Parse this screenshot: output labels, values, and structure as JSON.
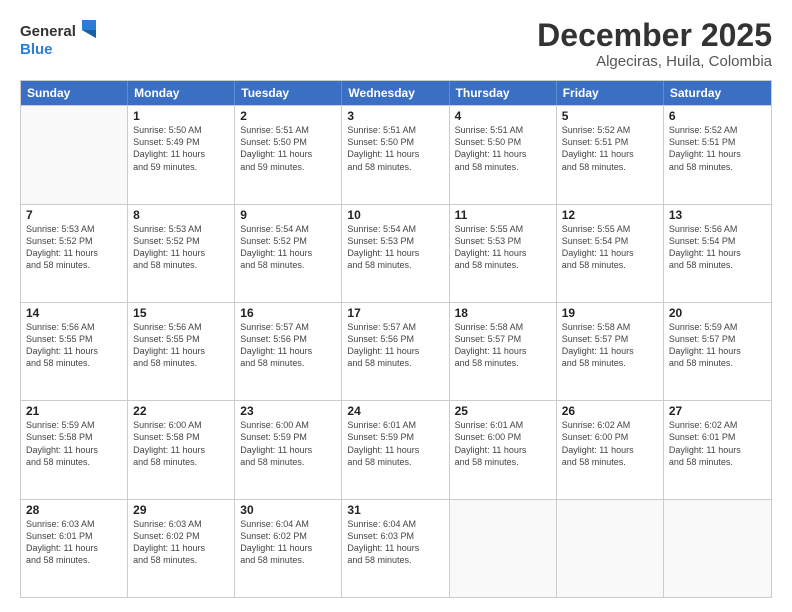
{
  "header": {
    "logo_line1": "General",
    "logo_line2": "Blue",
    "month": "December 2025",
    "location": "Algeciras, Huila, Colombia"
  },
  "weekdays": [
    "Sunday",
    "Monday",
    "Tuesday",
    "Wednesday",
    "Thursday",
    "Friday",
    "Saturday"
  ],
  "rows": [
    [
      {
        "day": "",
        "info": ""
      },
      {
        "day": "1",
        "info": "Sunrise: 5:50 AM\nSunset: 5:49 PM\nDaylight: 11 hours\nand 59 minutes."
      },
      {
        "day": "2",
        "info": "Sunrise: 5:51 AM\nSunset: 5:50 PM\nDaylight: 11 hours\nand 59 minutes."
      },
      {
        "day": "3",
        "info": "Sunrise: 5:51 AM\nSunset: 5:50 PM\nDaylight: 11 hours\nand 58 minutes."
      },
      {
        "day": "4",
        "info": "Sunrise: 5:51 AM\nSunset: 5:50 PM\nDaylight: 11 hours\nand 58 minutes."
      },
      {
        "day": "5",
        "info": "Sunrise: 5:52 AM\nSunset: 5:51 PM\nDaylight: 11 hours\nand 58 minutes."
      },
      {
        "day": "6",
        "info": "Sunrise: 5:52 AM\nSunset: 5:51 PM\nDaylight: 11 hours\nand 58 minutes."
      }
    ],
    [
      {
        "day": "7",
        "info": "Sunrise: 5:53 AM\nSunset: 5:52 PM\nDaylight: 11 hours\nand 58 minutes."
      },
      {
        "day": "8",
        "info": "Sunrise: 5:53 AM\nSunset: 5:52 PM\nDaylight: 11 hours\nand 58 minutes."
      },
      {
        "day": "9",
        "info": "Sunrise: 5:54 AM\nSunset: 5:52 PM\nDaylight: 11 hours\nand 58 minutes."
      },
      {
        "day": "10",
        "info": "Sunrise: 5:54 AM\nSunset: 5:53 PM\nDaylight: 11 hours\nand 58 minutes."
      },
      {
        "day": "11",
        "info": "Sunrise: 5:55 AM\nSunset: 5:53 PM\nDaylight: 11 hours\nand 58 minutes."
      },
      {
        "day": "12",
        "info": "Sunrise: 5:55 AM\nSunset: 5:54 PM\nDaylight: 11 hours\nand 58 minutes."
      },
      {
        "day": "13",
        "info": "Sunrise: 5:56 AM\nSunset: 5:54 PM\nDaylight: 11 hours\nand 58 minutes."
      }
    ],
    [
      {
        "day": "14",
        "info": "Sunrise: 5:56 AM\nSunset: 5:55 PM\nDaylight: 11 hours\nand 58 minutes."
      },
      {
        "day": "15",
        "info": "Sunrise: 5:56 AM\nSunset: 5:55 PM\nDaylight: 11 hours\nand 58 minutes."
      },
      {
        "day": "16",
        "info": "Sunrise: 5:57 AM\nSunset: 5:56 PM\nDaylight: 11 hours\nand 58 minutes."
      },
      {
        "day": "17",
        "info": "Sunrise: 5:57 AM\nSunset: 5:56 PM\nDaylight: 11 hours\nand 58 minutes."
      },
      {
        "day": "18",
        "info": "Sunrise: 5:58 AM\nSunset: 5:57 PM\nDaylight: 11 hours\nand 58 minutes."
      },
      {
        "day": "19",
        "info": "Sunrise: 5:58 AM\nSunset: 5:57 PM\nDaylight: 11 hours\nand 58 minutes."
      },
      {
        "day": "20",
        "info": "Sunrise: 5:59 AM\nSunset: 5:57 PM\nDaylight: 11 hours\nand 58 minutes."
      }
    ],
    [
      {
        "day": "21",
        "info": "Sunrise: 5:59 AM\nSunset: 5:58 PM\nDaylight: 11 hours\nand 58 minutes."
      },
      {
        "day": "22",
        "info": "Sunrise: 6:00 AM\nSunset: 5:58 PM\nDaylight: 11 hours\nand 58 minutes."
      },
      {
        "day": "23",
        "info": "Sunrise: 6:00 AM\nSunset: 5:59 PM\nDaylight: 11 hours\nand 58 minutes."
      },
      {
        "day": "24",
        "info": "Sunrise: 6:01 AM\nSunset: 5:59 PM\nDaylight: 11 hours\nand 58 minutes."
      },
      {
        "day": "25",
        "info": "Sunrise: 6:01 AM\nSunset: 6:00 PM\nDaylight: 11 hours\nand 58 minutes."
      },
      {
        "day": "26",
        "info": "Sunrise: 6:02 AM\nSunset: 6:00 PM\nDaylight: 11 hours\nand 58 minutes."
      },
      {
        "day": "27",
        "info": "Sunrise: 6:02 AM\nSunset: 6:01 PM\nDaylight: 11 hours\nand 58 minutes."
      }
    ],
    [
      {
        "day": "28",
        "info": "Sunrise: 6:03 AM\nSunset: 6:01 PM\nDaylight: 11 hours\nand 58 minutes."
      },
      {
        "day": "29",
        "info": "Sunrise: 6:03 AM\nSunset: 6:02 PM\nDaylight: 11 hours\nand 58 minutes."
      },
      {
        "day": "30",
        "info": "Sunrise: 6:04 AM\nSunset: 6:02 PM\nDaylight: 11 hours\nand 58 minutes."
      },
      {
        "day": "31",
        "info": "Sunrise: 6:04 AM\nSunset: 6:03 PM\nDaylight: 11 hours\nand 58 minutes."
      },
      {
        "day": "",
        "info": ""
      },
      {
        "day": "",
        "info": ""
      },
      {
        "day": "",
        "info": ""
      }
    ]
  ]
}
